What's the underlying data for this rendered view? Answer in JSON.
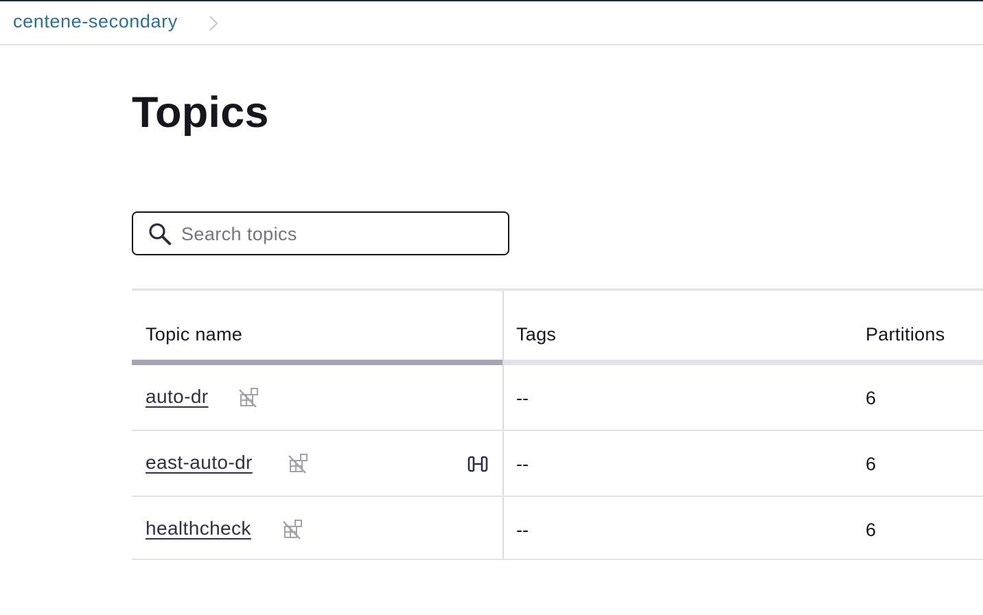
{
  "breadcrumb": {
    "cluster": "centene-secondary"
  },
  "page": {
    "title": "Topics"
  },
  "search": {
    "placeholder": "Search topics",
    "value": ""
  },
  "table": {
    "columns": [
      "Topic name",
      "Tags",
      "Partitions"
    ],
    "rows": [
      {
        "name": "auto-dr",
        "tags": "--",
        "partitions": "6",
        "icons": [
          "no-schema-icon"
        ]
      },
      {
        "name": "east-auto-dr",
        "tags": "--",
        "partitions": "6",
        "icons": [
          "no-schema-icon",
          "cluster-link-icon"
        ]
      },
      {
        "name": "healthcheck",
        "tags": "--",
        "partitions": "6",
        "icons": [
          "no-schema-icon"
        ]
      }
    ]
  }
}
